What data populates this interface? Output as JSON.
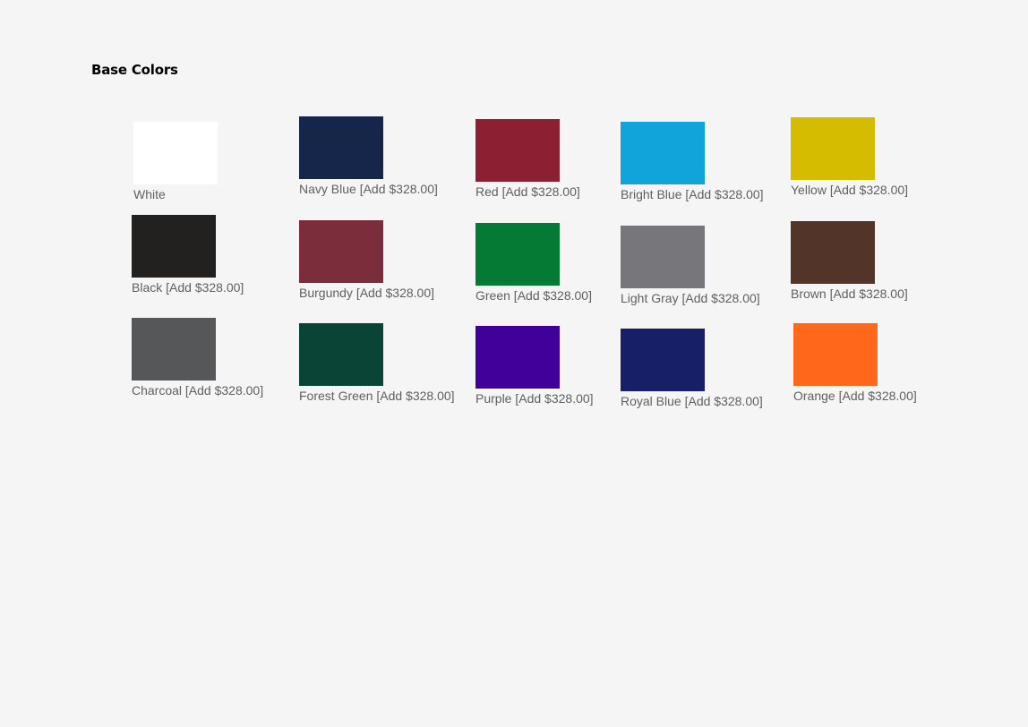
{
  "section": {
    "title": "Base Colors"
  },
  "swatches": [
    {
      "name": "White",
      "label": "White",
      "color": "#ffffff"
    },
    {
      "name": "Navy Blue",
      "label": "Navy Blue [Add $328.00]",
      "color": "#16264a"
    },
    {
      "name": "Red",
      "label": "Red [Add $328.00]",
      "color": "#8c1f32"
    },
    {
      "name": "Bright Blue",
      "label": "Bright Blue [Add $328.00]",
      "color": "#11a4db"
    },
    {
      "name": "Yellow",
      "label": "Yellow [Add $328.00]",
      "color": "#d6bc00"
    },
    {
      "name": "Black",
      "label": "Black [Add $328.00]",
      "color": "#222120"
    },
    {
      "name": "Burgundy",
      "label": "Burgundy [Add $328.00]",
      "color": "#7b2d3b"
    },
    {
      "name": "Green",
      "label": "Green [Add $328.00]",
      "color": "#047a34"
    },
    {
      "name": "Light Gray",
      "label": "Light Gray [Add $328.00]",
      "color": "#77767a"
    },
    {
      "name": "Brown",
      "label": "Brown [Add $328.00]",
      "color": "#533429"
    },
    {
      "name": "Charcoal",
      "label": "Charcoal [Add $328.00]",
      "color": "#555759"
    },
    {
      "name": "Forest Green",
      "label": "Forest Green [Add $328.00]",
      "color": "#0a4437"
    },
    {
      "name": "Purple",
      "label": "Purple [Add $328.00]",
      "color": "#410099"
    },
    {
      "name": "Royal Blue",
      "label": "Royal Blue [Add $328.00]",
      "color": "#171f66"
    },
    {
      "name": "Orange",
      "label": "Orange [Add $328.00]",
      "color": "#ff671b"
    }
  ]
}
